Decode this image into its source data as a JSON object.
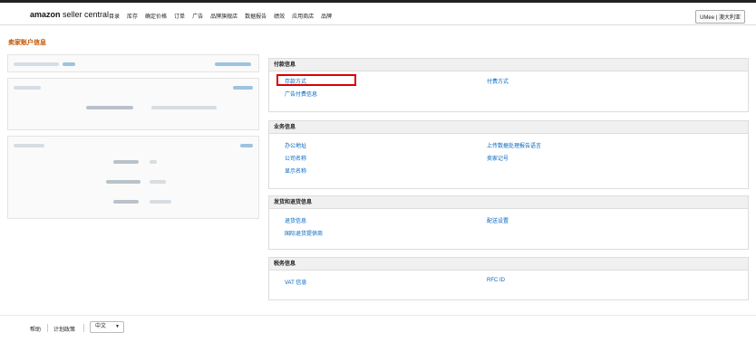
{
  "header": {
    "logo_brand": "amazon",
    "logo_product": "seller central",
    "nav": [
      "目录",
      "库存",
      "确定价格",
      "订单",
      "广告",
      "品牌旗舰店",
      "数据报告",
      "绩效",
      "应用商店",
      "品牌"
    ],
    "account_label": "UMee | 澳大利亚"
  },
  "page": {
    "title": "卖家账户信息"
  },
  "panels": {
    "payment": {
      "title": "付款信息",
      "deposit": "存款方式",
      "charge": "付费方式",
      "ad_charge": "广告付费信息"
    },
    "business": {
      "title": "业务信息",
      "office": "办公地址",
      "upload_lang": "上传数据处理报告语言",
      "company": "公司名称",
      "seller_id": "卖家记号",
      "display": "显示名称"
    },
    "shipping": {
      "title": "发货和退货信息",
      "returns": "退货信息",
      "delivery": "配送设置",
      "intl_returns": "国际退货提供商"
    },
    "tax": {
      "title": "税务信息",
      "vat": "VAT 信息",
      "rfc": "RFC ID"
    }
  },
  "footer": {
    "help": "帮助",
    "policy": "计划政策",
    "language": "中文"
  },
  "colors": {
    "link": "#0066c0",
    "title_orange": "#c45500",
    "highlight_red": "#dd0000"
  }
}
